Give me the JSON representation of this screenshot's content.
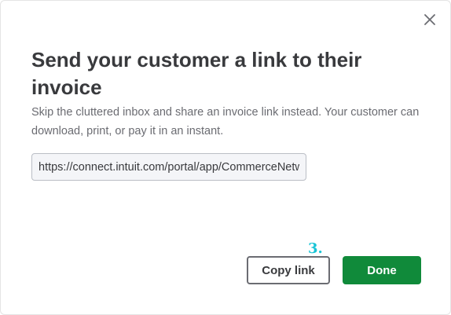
{
  "dialog": {
    "title": "Send your customer a link to their invoice",
    "description": "Skip the cluttered inbox and share an invoice link instead. Your customer can download, print, or pay it in an instant.",
    "link_value": "https://connect.intuit.com/portal/app/CommerceNetwork/view/",
    "close_icon": "close-icon",
    "step_marker": "3.",
    "buttons": {
      "copy_label": "Copy link",
      "done_label": "Done"
    }
  },
  "colors": {
    "title": "#393a3d",
    "description": "#6b6c72",
    "done_button": "#108a3a",
    "step_marker": "#19c4d6"
  }
}
